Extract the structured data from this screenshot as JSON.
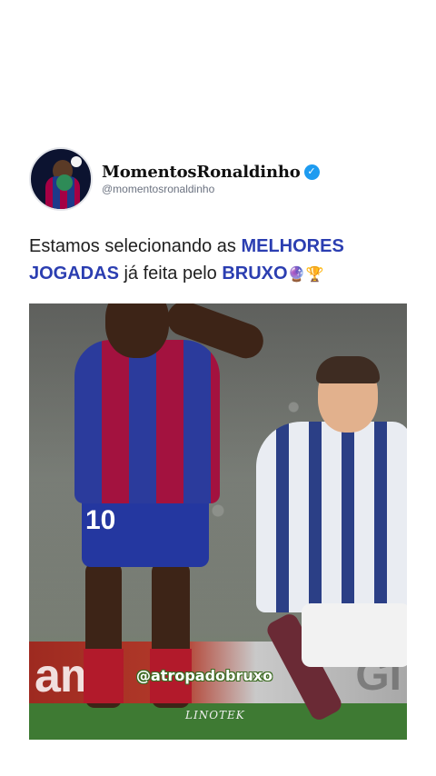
{
  "account": {
    "display_name": "MomentosRonaldinho",
    "handle": "@momentosronaldinho",
    "verified_icon": "verified-badge-icon"
  },
  "post": {
    "caption_part1": "Estamos selecionando as ",
    "caption_highlight1": "MELHORES JOGADAS",
    "caption_part2": " já feita pelo ",
    "caption_highlight2": "BRUXO",
    "caption_emojis": "🔮🏆"
  },
  "media": {
    "watermark": "@atropadobruxo",
    "secondary_watermark": "LINOTEK",
    "banner_text_left": "am",
    "banner_text_right": "GI",
    "shirt_number": "10"
  },
  "colors": {
    "highlight": "#2b3eb1",
    "verified": "#1d9bf0",
    "text": "#1f1f1f"
  }
}
